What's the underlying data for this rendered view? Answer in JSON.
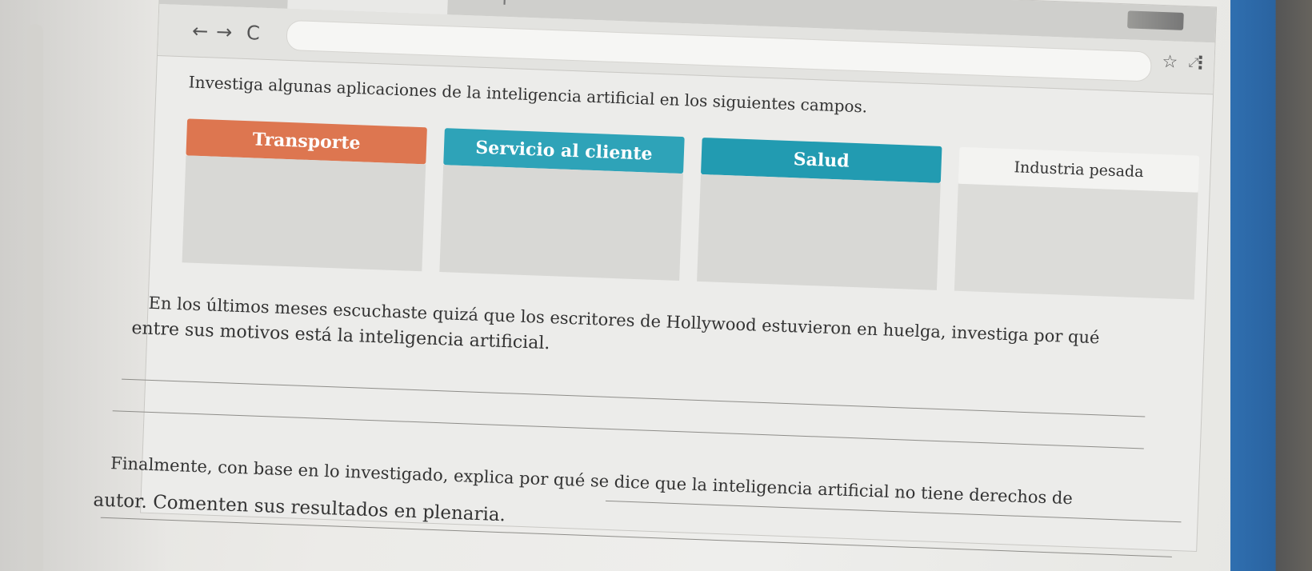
{
  "browser": {
    "nav": {
      "back_icon": "←",
      "forward_icon": "→",
      "reload_icon": "C"
    },
    "new_tab_icon": "+",
    "star_icon": "☆",
    "menu_icon": "⋮",
    "expand_icon": "⤢"
  },
  "instruction": "Investiga algunas aplicaciones de la inteligencia artificial en los siguientes campos.",
  "fields": [
    {
      "label": "Transporte",
      "color": "#dd7650"
    },
    {
      "label": "Servicio al cliente",
      "color": "#2ea3b8"
    },
    {
      "label": "Salud",
      "color": "#229bb1"
    },
    {
      "label": "Industria pesada",
      "color": "#f3f3f1"
    }
  ],
  "question1": {
    "line1": "En los últimos meses escuchaste quizá que los escritores de Hollywood estuvieron en huelga, investiga por qué",
    "line2": "entre sus motivos está la inteligencia artificial."
  },
  "question2": {
    "line1": "Finalmente, con base en lo investigado, explica por qué se dice que la inteligencia artificial no tiene derechos de",
    "line2": "autor. Comenten sus resultados en plenaria."
  },
  "colors": {
    "accent_blue": "#2f6fb0",
    "orange": "#dd7650",
    "teal": "#2ea3b8"
  }
}
